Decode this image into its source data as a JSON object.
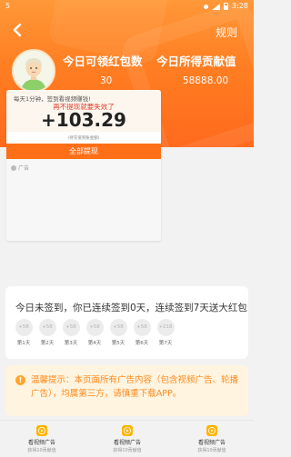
{
  "status_bar": {
    "left_text": "5",
    "time": "3:28"
  },
  "header": {
    "rules_label": "规则",
    "redeemable_label": "今日可领红包数",
    "redeemable_value": "30",
    "contribution_label": "今日所得贡献值",
    "contribution_value": "58888.00"
  },
  "video_card": {
    "hint": "每天1分钟，签到看视频赚钱!",
    "warning": "再不提现就要失效了",
    "amount": "+103.29",
    "amount_note": "(待充值到账金额)",
    "withdraw_button": "全部提现",
    "ad_tag": "广告"
  },
  "signin": {
    "title": "今日未签到，你已连续签到0天，连续签到7天送大红包",
    "days": [
      {
        "reward": "+58",
        "label": "第1天"
      },
      {
        "reward": "+58",
        "label": "第2天"
      },
      {
        "reward": "+58",
        "label": "第3天"
      },
      {
        "reward": "+58",
        "label": "第4天"
      },
      {
        "reward": "+58",
        "label": "第5天"
      },
      {
        "reward": "+58",
        "label": "第6天"
      },
      {
        "reward": "+218",
        "label": "第7天"
      }
    ]
  },
  "notice": {
    "icon": "!",
    "text": "温馨提示：本页面所有广告内容（包含视频广告、轮播广告），均属第三方，请慎重下载APP。"
  },
  "bottom_tabs": [
    {
      "label": "看视频广告",
      "sub": "获得10贡献值"
    },
    {
      "label": "看视频广告",
      "sub": "获得10贡献值"
    },
    {
      "label": "看视频广告",
      "sub": "获得10贡献值"
    }
  ],
  "colors": {
    "header_orange": "#ff7e22",
    "button_orange": "#ff6f17",
    "notice_text": "#ff8a1f",
    "notice_bg": "#fff4df",
    "warning_red": "#e23b2a"
  },
  "icons": {
    "back": "chevron-left-icon",
    "avatar": "person-avatar",
    "tab": "play-video-icon"
  }
}
